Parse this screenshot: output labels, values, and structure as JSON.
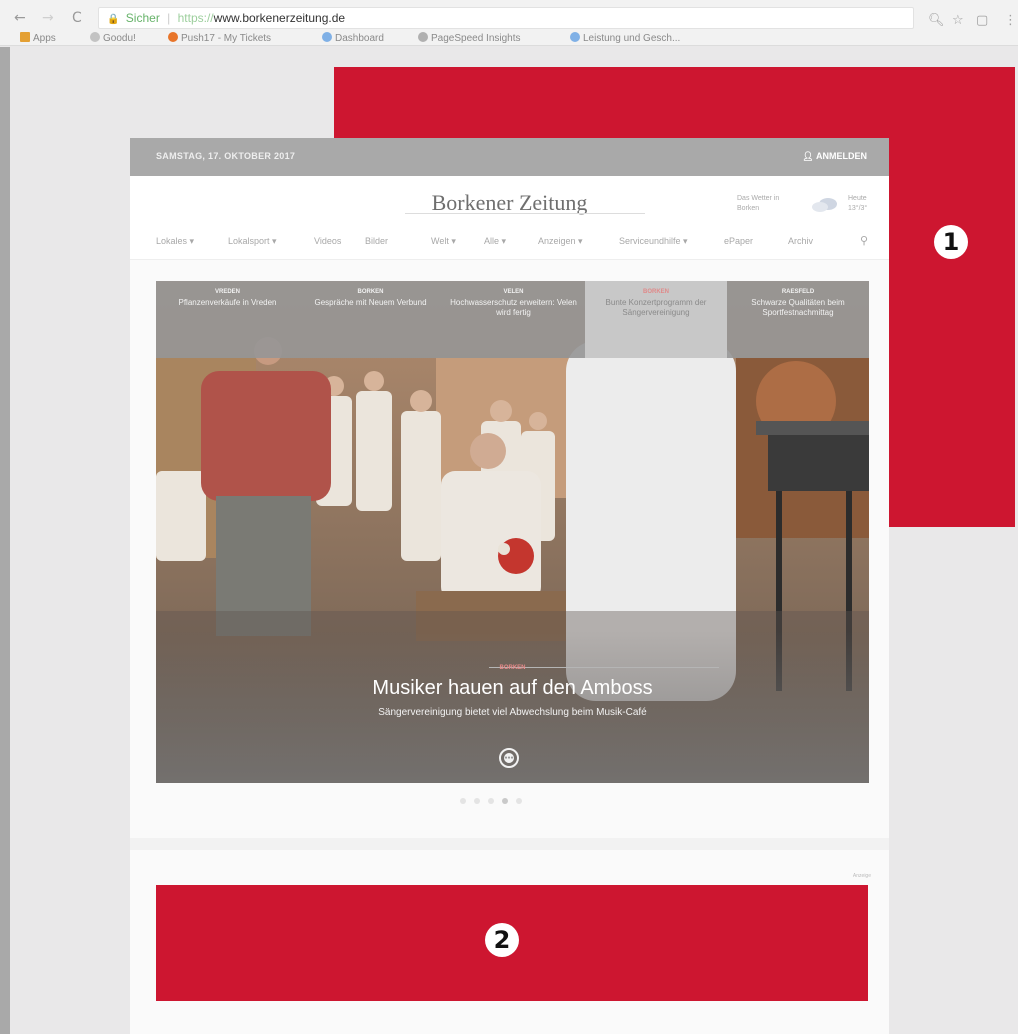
{
  "browser": {
    "back": "←",
    "forward": "→",
    "reload": "C",
    "secure_label": "Sicher",
    "url_protocol": "https://",
    "url_host": "www.borkenerzeitung.de",
    "bookmarks": [
      {
        "label": "Apps",
        "icon": "apps-grid-icon",
        "color": "#e4a034"
      },
      {
        "label": "Goodu!",
        "icon": "goodu-icon",
        "color": "#c3c3c3"
      },
      {
        "label": "Push17 - My Tickets",
        "icon": "push17-icon",
        "color": "#e8752a"
      },
      {
        "label": "Dashboard",
        "icon": "google-icon",
        "color": "#7fb0e6"
      },
      {
        "label": "PageSpeed Insights",
        "icon": "pagespeed-icon",
        "color": "#b0b0b0"
      },
      {
        "label": "Leistung und Gesch...",
        "icon": "google-icon",
        "color": "#7fb0e6"
      }
    ]
  },
  "site": {
    "date": "SAMSTAG, 17. OKTOBER 2017",
    "login": "ANMELDEN",
    "logo": "Borkener Zeitung",
    "weather_label": "Das Wetter in",
    "weather_city": "Borken",
    "weather_day": "Heute",
    "weather_temp": "13°/3°",
    "nav": [
      "Lokales",
      "Lokalsport",
      "Videos",
      "Bilder",
      "Welt",
      "Alle",
      "Anzeigen",
      "Serviceundhilfe",
      "ePaper",
      "Archiv"
    ],
    "teasers": [
      {
        "cat": "VREDEN",
        "headline": "Pflanzenverkäufe in Vreden",
        "active": false
      },
      {
        "cat": "BORKEN",
        "headline": "Gespräche mit Neuem Verbund",
        "active": false
      },
      {
        "cat": "VELEN",
        "headline": "Hochwasserschutz erweitern: Velen wird fertig",
        "active": false
      },
      {
        "cat": "BORKEN",
        "headline": "Bunte Konzertprogramm der Sängervereinigung",
        "active": true
      },
      {
        "cat": "RAESFELD",
        "headline": "Schwarze Qualitäten beim Sportfestnachmittag",
        "active": false
      }
    ],
    "hero_cat": "BORKEN",
    "hero_title": "Musiker hauen auf den Amboss",
    "hero_subtitle": "Sängervereinigung bietet viel Abwechslung beim Musik-Café",
    "ad_label": "Anzeige",
    "slide_count": 5,
    "active_slide": 4
  },
  "annotations": {
    "callout1": "1",
    "callout2": "2",
    "color": "#cd1630"
  }
}
